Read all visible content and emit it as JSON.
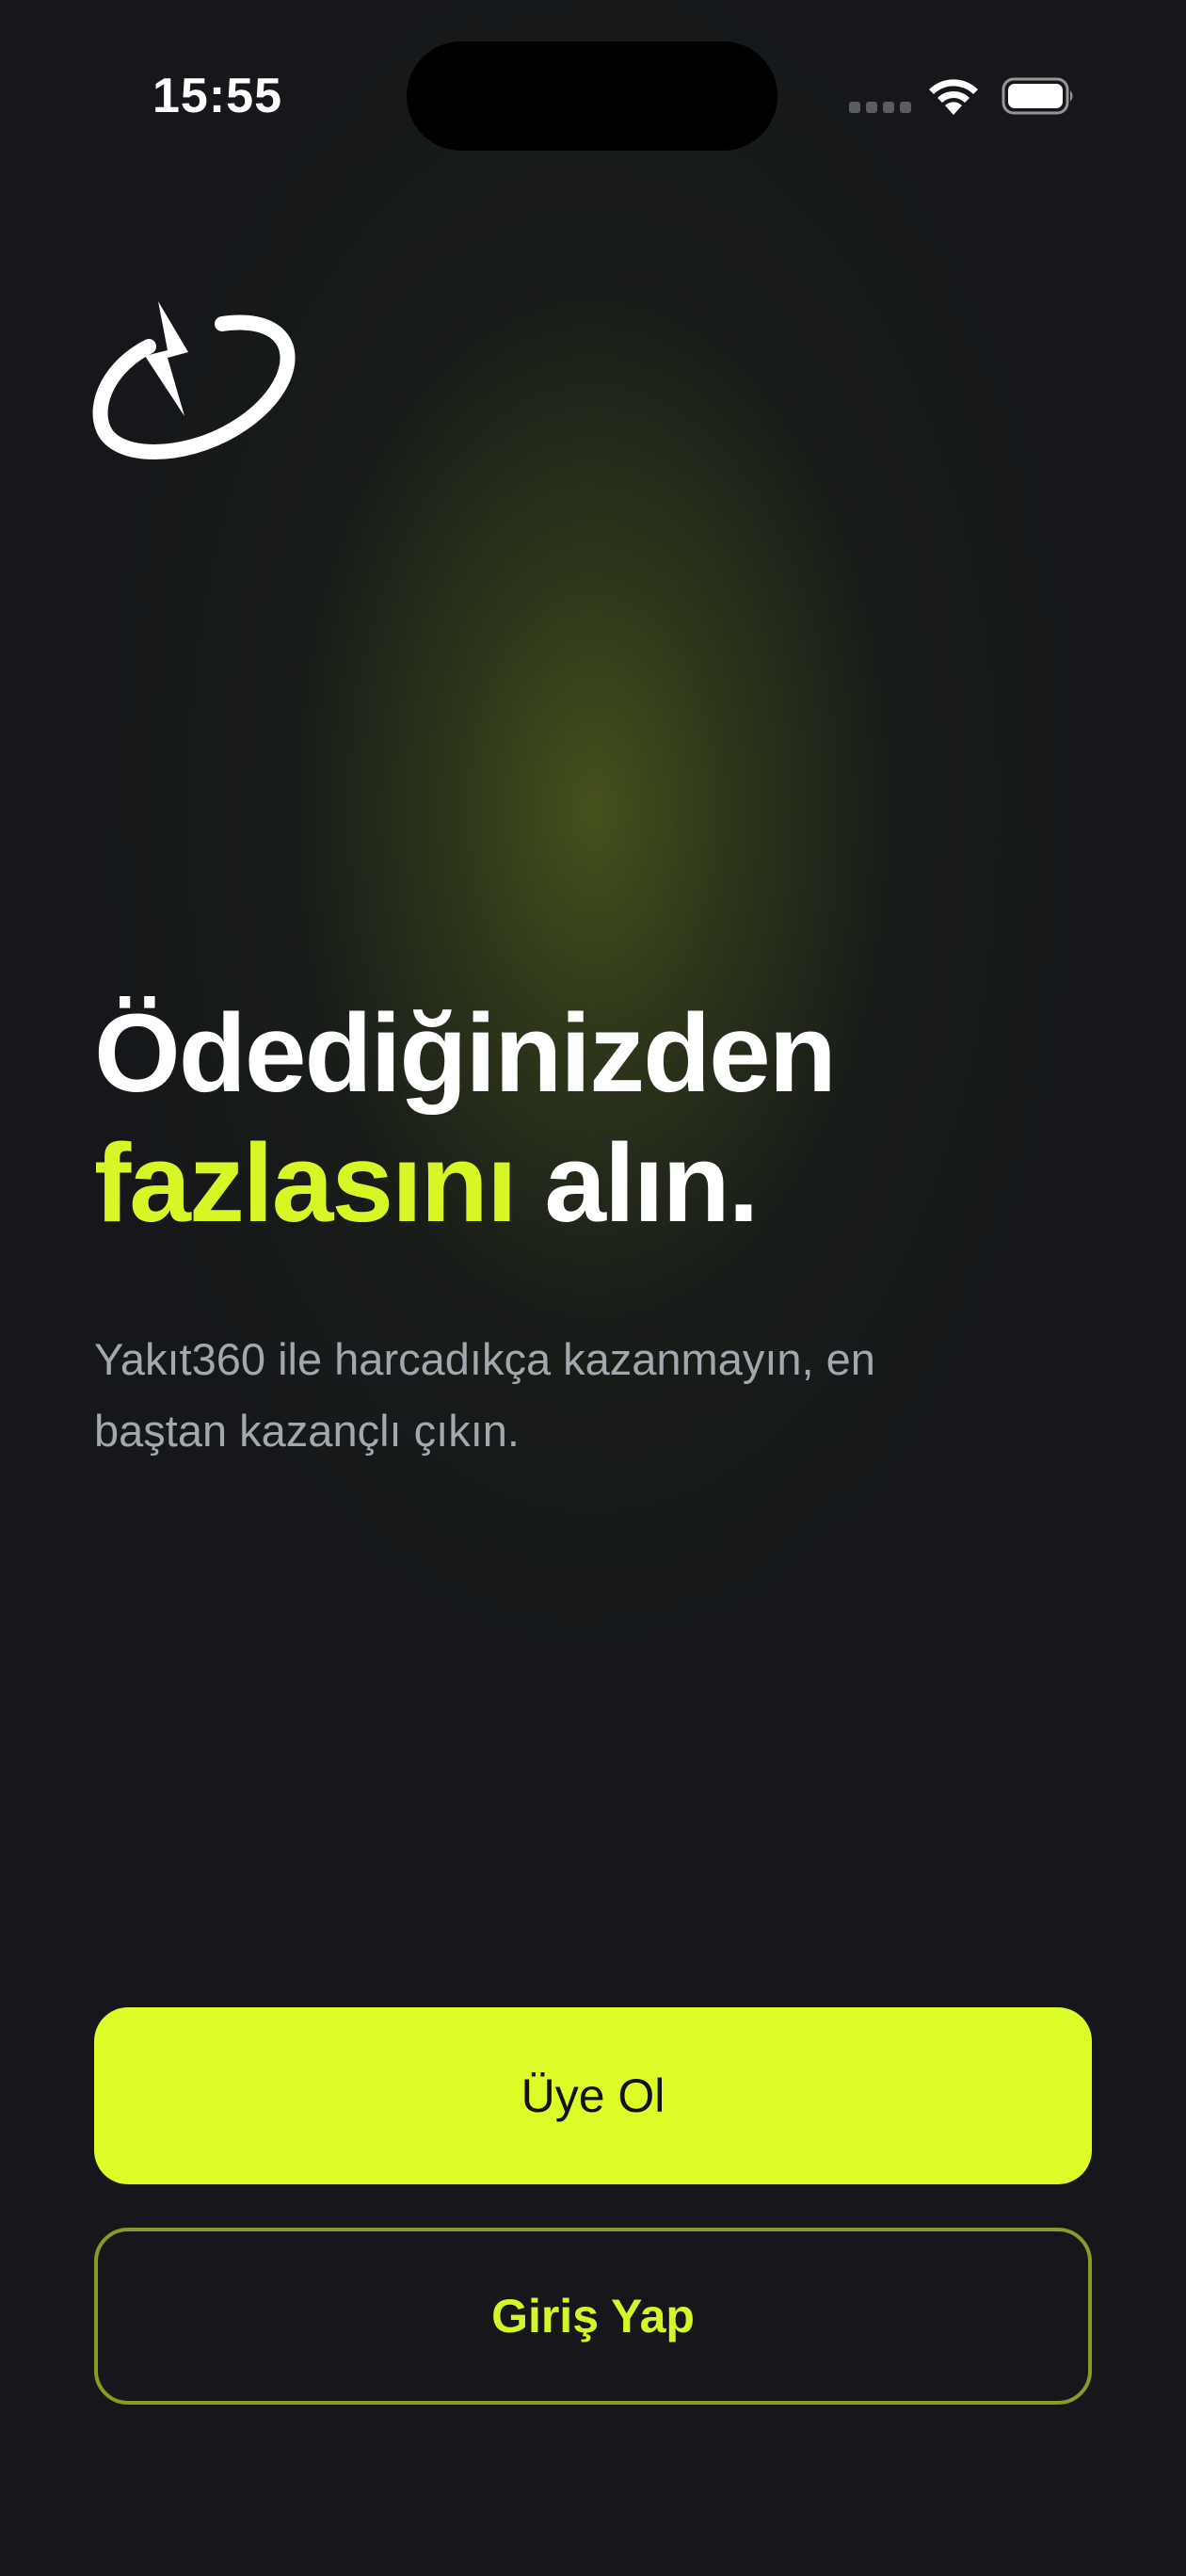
{
  "status_bar": {
    "time": "15:55",
    "icons": [
      "cellular-signal-icon",
      "wifi-icon",
      "battery-icon"
    ]
  },
  "brand": {
    "logo_icon": "lightning-orbit-logo-icon",
    "accent_color": "#DEFC27",
    "background_color": "#15171A"
  },
  "hero": {
    "line1": "Ödediğinizden",
    "highlight": "fazlasını",
    "rest": " alın.",
    "subtitle_line1": "Yakıt360 ile harcadıkça kazanmayın, en",
    "subtitle_line2": "baştan kazançlı çıkın."
  },
  "actions": {
    "signup_label": "Üye Ol",
    "login_label": "Giriş Yap"
  }
}
